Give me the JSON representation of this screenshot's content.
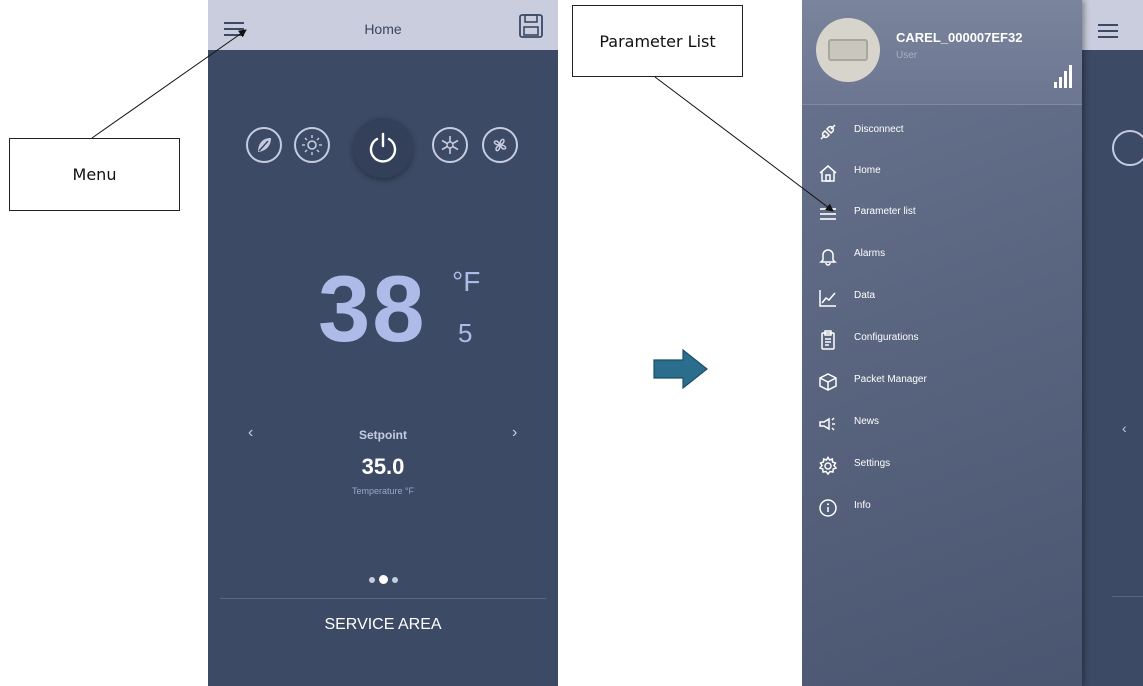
{
  "callouts": {
    "menu": "Menu",
    "parameter_list": "Parameter List"
  },
  "home_screen": {
    "title": "Home",
    "temperature": "38",
    "unit": "°F",
    "probe": "5",
    "nav_prev": "‹",
    "nav_next": "›",
    "setpoint_label": "Setpoint",
    "setpoint_value": "35.0",
    "setpoint_unit_label": "Temperature °F",
    "service_area": "SERVICE AREA",
    "mode_icons": [
      "leaf-icon",
      "light-icon",
      "power-icon",
      "defrost-icon",
      "fan-icon"
    ]
  },
  "drawer": {
    "device_name": "CAREL_000007EF32",
    "role": "User",
    "items": [
      {
        "label": "Disconnect",
        "icon": "disconnect-icon"
      },
      {
        "label": "Home",
        "icon": "home-icon"
      },
      {
        "label": "Parameter list",
        "icon": "parameter-list-icon"
      },
      {
        "label": "Alarms",
        "icon": "bell-icon"
      },
      {
        "label": "Data",
        "icon": "chart-icon"
      },
      {
        "label": "Configurations",
        "icon": "clipboard-icon"
      },
      {
        "label": "Packet Manager",
        "icon": "package-icon"
      },
      {
        "label": "News",
        "icon": "megaphone-icon"
      },
      {
        "label": "Settings",
        "icon": "gear-icon"
      },
      {
        "label": "Info",
        "icon": "info-icon"
      }
    ]
  },
  "background_screen": {
    "nav_prev": "‹"
  },
  "colors": {
    "screen_bg": "#3c4a65",
    "topbar_bg": "#c9cddd",
    "accent_temp": "#aebbe9",
    "arrow": "#2a6d8c"
  }
}
